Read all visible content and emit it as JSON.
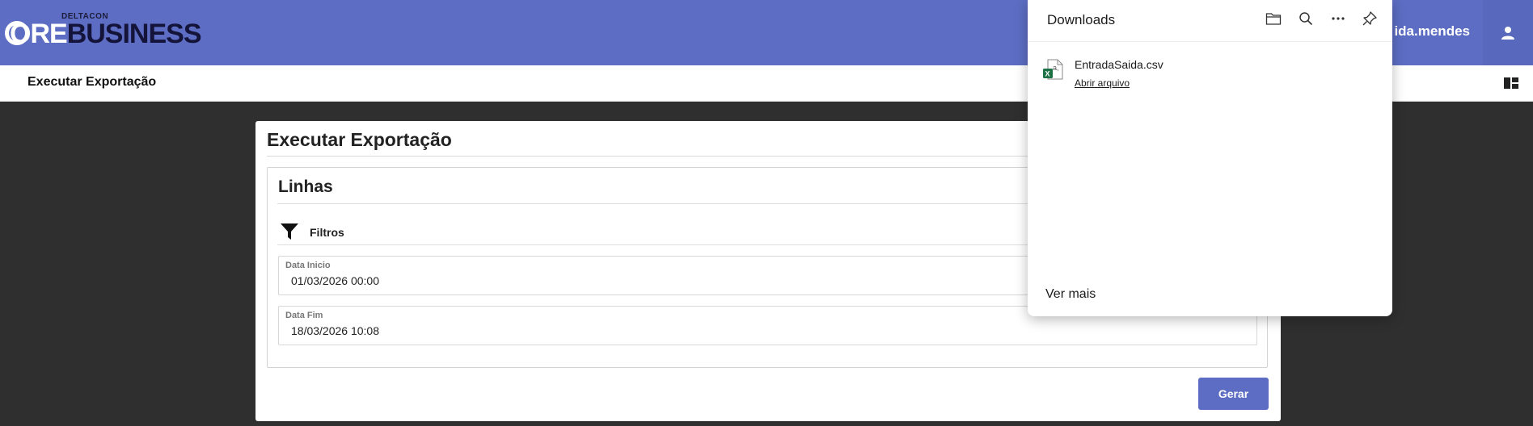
{
  "header": {
    "logo_small": "DELTACON",
    "logo_ore": "ORE",
    "logo_business": "BUSINESS",
    "user_name": "ida.mendes",
    "brand_color": "#5d6dc3"
  },
  "subheader": {
    "title": "Executar Exportação"
  },
  "card": {
    "title": "Executar Exportação",
    "panel_title": "Linhas",
    "filters_label": "Filtros",
    "fields": [
      {
        "label": "Data Inicio",
        "value": "01/03/2026 00:00"
      },
      {
        "label": "Data Fim",
        "value": "18/03/2026 10:08"
      }
    ],
    "generate_button": "Gerar"
  },
  "downloads": {
    "title": "Downloads",
    "tools": [
      "folder-icon",
      "search-icon",
      "more-icon",
      "pin-icon"
    ],
    "file_name": "EntradaSaida.csv",
    "open_label": "Abrir arquivo",
    "see_more": "Ver mais"
  }
}
